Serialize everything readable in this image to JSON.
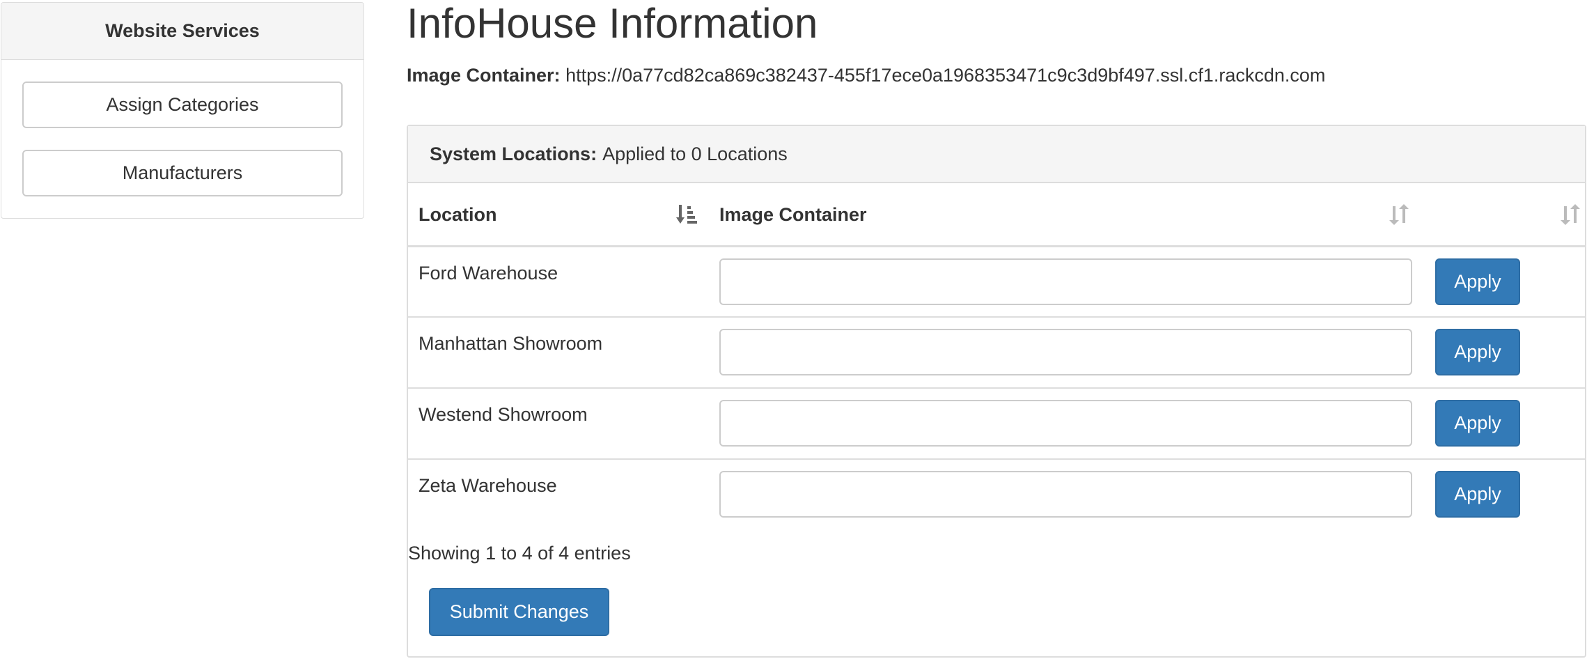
{
  "sidebar": {
    "heading": "Website Services",
    "buttons": [
      {
        "label": "Assign Categories"
      },
      {
        "label": "Manufacturers"
      }
    ]
  },
  "page": {
    "title": "InfoHouse Information",
    "image_container_label": "Image Container:",
    "image_container_value": "https://0a77cd82ca869c382437-455f17ece0a1968353471c9c3d9bf497.ssl.cf1.rackcdn.com"
  },
  "panel": {
    "heading_label": "System Locations:",
    "heading_value": "Applied to 0 Locations",
    "columns": [
      "Location",
      "Image Container",
      ""
    ],
    "rows": [
      {
        "location": "Ford Warehouse",
        "container_value": "",
        "apply_label": "Apply"
      },
      {
        "location": "Manhattan Showroom",
        "container_value": "",
        "apply_label": "Apply"
      },
      {
        "location": "Westend Showroom",
        "container_value": "",
        "apply_label": "Apply"
      },
      {
        "location": "Zeta Warehouse",
        "container_value": "",
        "apply_label": "Apply"
      }
    ],
    "showing_text": "Showing 1 to 4 of 4 entries",
    "submit_label": "Submit Changes"
  },
  "colors": {
    "primary": "#337ab7",
    "panel_heading_bg": "#f5f5f5",
    "border": "#dddddd",
    "text": "#333333",
    "sort_icon_active": "#666666",
    "sort_icon_inactive": "#bbbbbb"
  },
  "icons": {
    "location_sort": "sort-amount-asc-icon",
    "container_sort": "sort-icon",
    "action_sort": "sort-icon"
  }
}
